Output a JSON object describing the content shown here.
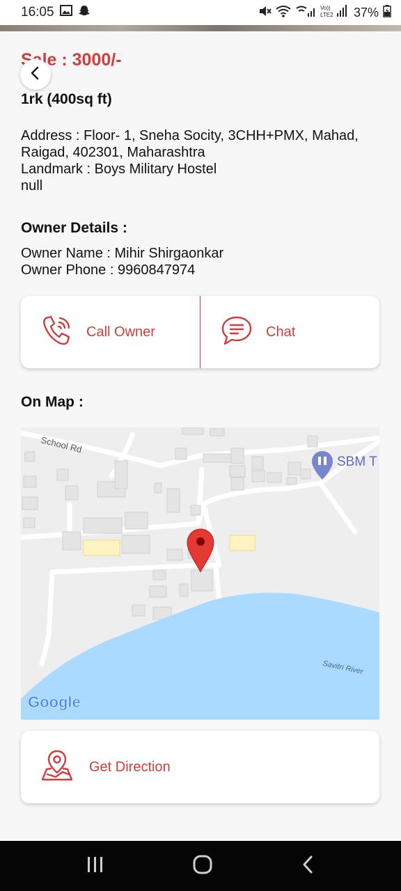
{
  "status_bar": {
    "time": "16:05",
    "battery": "37%",
    "network": "VoLTE2"
  },
  "listing": {
    "price": "Sale : 3000/-",
    "title": "1rk (400sq ft)",
    "address_lines": [
      "Address : Floor- 1, Sneha Socity, 3CHH+PMX, Mahad,",
      "Raigad, 402301, Maharashtra",
      "Landmark : Boys Military Hostel",
      "null"
    ]
  },
  "owner": {
    "heading": "Owner Details :",
    "name_line": "Owner Name : Mihir Shirgaonkar",
    "phone_line": "Owner Phone : 9960847974"
  },
  "actions": {
    "call_label": "Call Owner",
    "chat_label": "Chat"
  },
  "map": {
    "heading": "On Map :",
    "road_label": "School Rd",
    "poi_label": "SBM T",
    "river_label": "Savitri River",
    "attribution": "Google"
  },
  "direction": {
    "label": "Get Direction"
  },
  "colors": {
    "accent": "#d23c3c",
    "water": "#aadaff",
    "map_bg": "#eeeeee",
    "pin": "#e53935"
  },
  "icons": {
    "back": "chevron-left-icon",
    "call": "phone-icon",
    "chat": "chat-bubble-icon",
    "direction": "map-location-icon"
  }
}
